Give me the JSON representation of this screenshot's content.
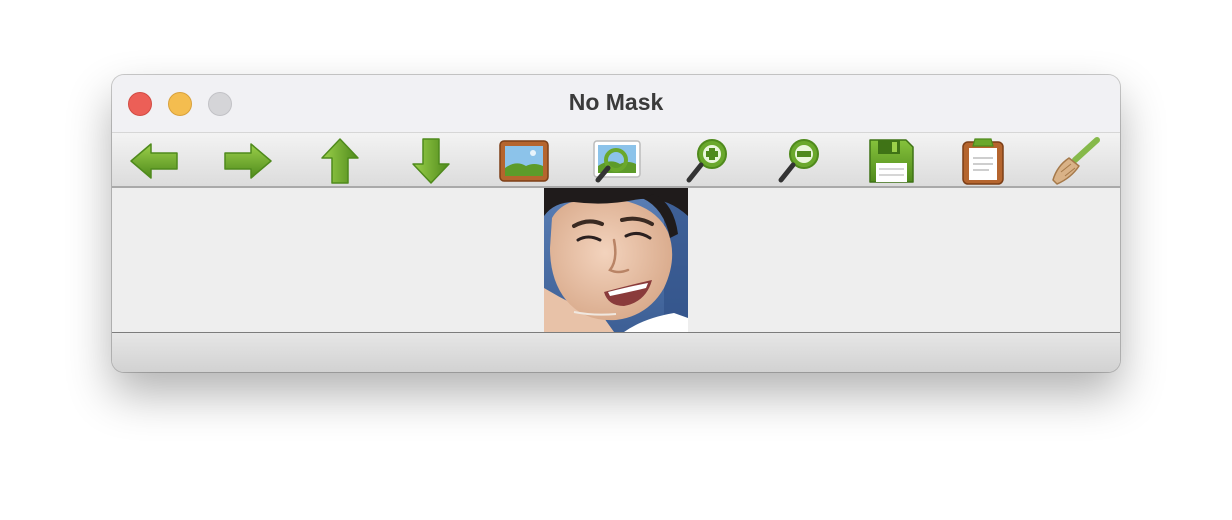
{
  "window": {
    "title": "No Mask"
  },
  "toolbar": {
    "buttons": [
      {
        "name": "back-button",
        "icon": "arrow-left-icon"
      },
      {
        "name": "forward-button",
        "icon": "arrow-right-icon"
      },
      {
        "name": "up-button",
        "icon": "arrow-up-icon"
      },
      {
        "name": "down-button",
        "icon": "arrow-down-icon"
      },
      {
        "name": "fit-image-button",
        "icon": "picture-frame-icon"
      },
      {
        "name": "zoom-to-fit-button",
        "icon": "picture-magnify-icon"
      },
      {
        "name": "zoom-in-button",
        "icon": "zoom-in-icon"
      },
      {
        "name": "zoom-out-button",
        "icon": "zoom-out-icon"
      },
      {
        "name": "save-button",
        "icon": "floppy-disk-icon"
      },
      {
        "name": "clipboard-button",
        "icon": "clipboard-icon"
      },
      {
        "name": "clear-button",
        "icon": "broom-icon"
      }
    ]
  },
  "colors": {
    "icon_green": "#6aa82c",
    "icon_green_dark": "#4f8a1c",
    "frame_brown": "#b5652e",
    "titlebar_bg": "#f1f1f4"
  },
  "image": {
    "subject": "face-photo"
  }
}
